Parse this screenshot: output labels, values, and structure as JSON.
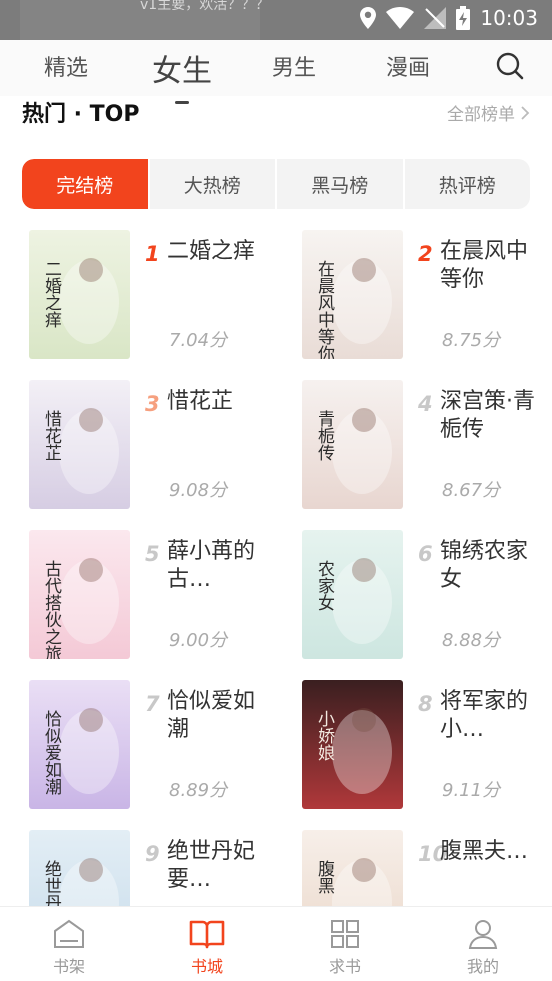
{
  "status_bar": {
    "time": "10:03",
    "background_hint": "v1主要，欢活？？？"
  },
  "top_tabs": [
    {
      "label": "精选",
      "active": false
    },
    {
      "label": "女生",
      "active": true
    },
    {
      "label": "男生",
      "active": false
    },
    {
      "label": "漫画",
      "active": false
    }
  ],
  "section": {
    "title": "热门 · TOP",
    "more": "全部榜单"
  },
  "rank_tabs": [
    {
      "label": "完结榜",
      "active": true
    },
    {
      "label": "大热榜",
      "active": false
    },
    {
      "label": "黑马榜",
      "active": false
    },
    {
      "label": "热评榜",
      "active": false
    }
  ],
  "books": [
    {
      "rank": "1",
      "title": "二婚之痒",
      "score": "7.04分",
      "cover_text": "二婚之痒",
      "cover_colors": [
        "#eef3e2",
        "#d9e6c6"
      ]
    },
    {
      "rank": "2",
      "title": "在晨风中等你",
      "score": "8.75分",
      "cover_text": "在晨风中等你",
      "cover_colors": [
        "#f7f4f1",
        "#e9dcd6"
      ]
    },
    {
      "rank": "3",
      "title": "惜花芷",
      "score": "9.08分",
      "cover_text": "惜花芷",
      "cover_colors": [
        "#f3f0f6",
        "#d6cde3"
      ]
    },
    {
      "rank": "4",
      "title": "深宫策·青栀传",
      "score": "8.67分",
      "cover_text": "青栀传",
      "cover_colors": [
        "#f6f1ef",
        "#e8d6d0"
      ]
    },
    {
      "rank": "5",
      "title": "薛小苒的古…",
      "score": "9.00分",
      "cover_text": "古代搭伙之旅",
      "cover_colors": [
        "#fbe8ee",
        "#f4c9d6"
      ]
    },
    {
      "rank": "6",
      "title": "锦绣农家女",
      "score": "8.88分",
      "cover_text": "农家女",
      "cover_colors": [
        "#e6f3ef",
        "#cde6e0"
      ]
    },
    {
      "rank": "7",
      "title": "恰似爱如潮",
      "score": "8.89分",
      "cover_text": "恰似爱如潮",
      "cover_colors": [
        "#eadff5",
        "#c9b5e6"
      ]
    },
    {
      "rank": "8",
      "title": "将军家的小…",
      "score": "9.11分",
      "cover_text": "小娇娘",
      "cover_colors": [
        "#3a1f20",
        "#b0383a"
      ]
    },
    {
      "rank": "9",
      "title": "绝世丹妃要…",
      "score": "",
      "cover_text": "绝世丹",
      "cover_colors": [
        "#e3eef5",
        "#c8dceb"
      ]
    },
    {
      "rank": "10",
      "title": "腹黑夫…",
      "score": "",
      "cover_text": "腹黑",
      "cover_colors": [
        "#f7efe9",
        "#ead7c9"
      ]
    }
  ],
  "bottom_nav": [
    {
      "label": "书架",
      "icon": "bookshelf-icon",
      "active": false
    },
    {
      "label": "书城",
      "icon": "book-open-icon",
      "active": true
    },
    {
      "label": "求书",
      "icon": "grid-icon",
      "active": false
    },
    {
      "label": "我的",
      "icon": "user-icon",
      "active": false
    }
  ],
  "colors": {
    "accent": "#f2441d",
    "rank_top": "#f2441d",
    "rank_third": "#f6a07f",
    "rank_other": "#c8c8c8"
  }
}
